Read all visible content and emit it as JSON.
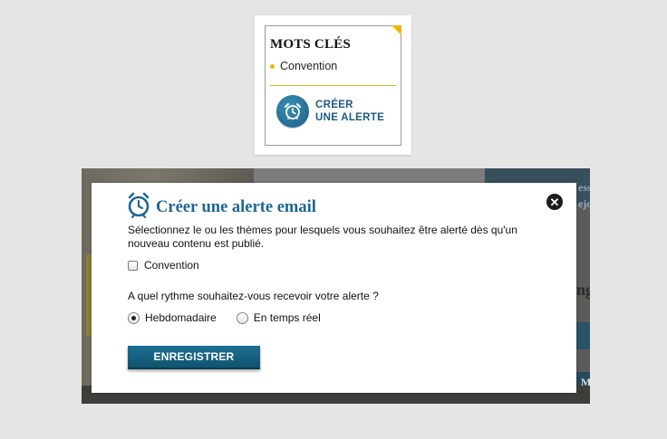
{
  "keywords_card": {
    "title": "MOTS CLÉS",
    "items": [
      "Convention"
    ],
    "alert_button": {
      "line1": "CRÉER",
      "line2": "UNE ALERTE",
      "icon": "alarm-clock-icon"
    },
    "accent_color": "#f1b400",
    "brand_color": "#1d5a82"
  },
  "background": {
    "letters": [
      "ess",
      "ejo",
      "ng",
      "M"
    ]
  },
  "modal": {
    "title": "Créer une alerte email",
    "title_icon": "alarm-clock-icon",
    "close_icon": "close-icon",
    "description": "Sélectionnez le ou les thèmes pour lesquels vous souhaitez être alerté dès qu'un nouveau contenu est publié.",
    "themes": [
      {
        "label": "Convention",
        "checked": false
      }
    ],
    "question": "A quel rythme souhaitez-vous recevoir votre alerte ?",
    "frequencies": [
      {
        "label": "Hebdomadaire",
        "selected": true
      },
      {
        "label": "En temps réel",
        "selected": false
      }
    ],
    "save_label": "ENREGISTRER",
    "title_color": "#1f6791",
    "button_color": "#1a6488"
  }
}
